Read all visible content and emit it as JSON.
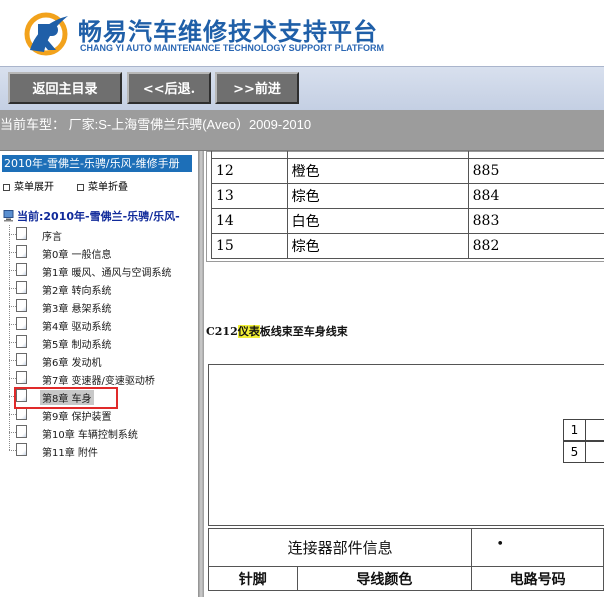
{
  "brand": {
    "name_cn": "畅易汽车维修技术支持平台",
    "name_en": "CHANG YI AUTO MAINTENANCE TECHNOLOGY SUPPORT PLATFORM",
    "accent": "#1f5fa8"
  },
  "nav": {
    "back_home": "返回主目录",
    "back": "<<后退.",
    "forward": ">>前进"
  },
  "current_model": "当前车型： 厂家:S-上海雪佛兰乐骋(Aveo）2009-2010",
  "sidebar": {
    "title": "2010年-雪佛兰-乐骋/乐风-维修手册",
    "expand": "菜单展开",
    "collapse": "菜单折叠",
    "root": "当前:2010年-雪佛兰-乐骋/乐风-",
    "items": [
      {
        "label": "序言"
      },
      {
        "label": "第0章 一般信息"
      },
      {
        "label": "第1章 暖风、通风与空调系统"
      },
      {
        "label": "第2章 转向系统"
      },
      {
        "label": "第3章 悬架系统"
      },
      {
        "label": "第4章 驱动系统"
      },
      {
        "label": "第5章 制动系统"
      },
      {
        "label": "第6章 发动机"
      },
      {
        "label": "第7章 变速器/变速驱动桥"
      },
      {
        "label": "第8章 车身",
        "selected": true
      },
      {
        "label": "第9章 保护装置"
      },
      {
        "label": "第10章 车辆控制系统"
      },
      {
        "label": "第11章 附件"
      }
    ]
  },
  "color_table": {
    "rows": [
      {
        "num": "12",
        "color": "橙色",
        "code": "885"
      },
      {
        "num": "13",
        "color": "棕色",
        "code": "884"
      },
      {
        "num": "14",
        "color": "白色",
        "code": "883"
      },
      {
        "num": "15",
        "color": "棕色",
        "code": "882"
      }
    ]
  },
  "connector": {
    "code": "C212",
    "highlight": "仪表",
    "rest": "板线束至车身线束",
    "pins": [
      "1",
      "5"
    ]
  },
  "info": {
    "header": "连接器部件信息",
    "bullet": "•",
    "col_pin": "针脚",
    "col_wire": "导线颜色",
    "col_circuit": "电路号码"
  }
}
